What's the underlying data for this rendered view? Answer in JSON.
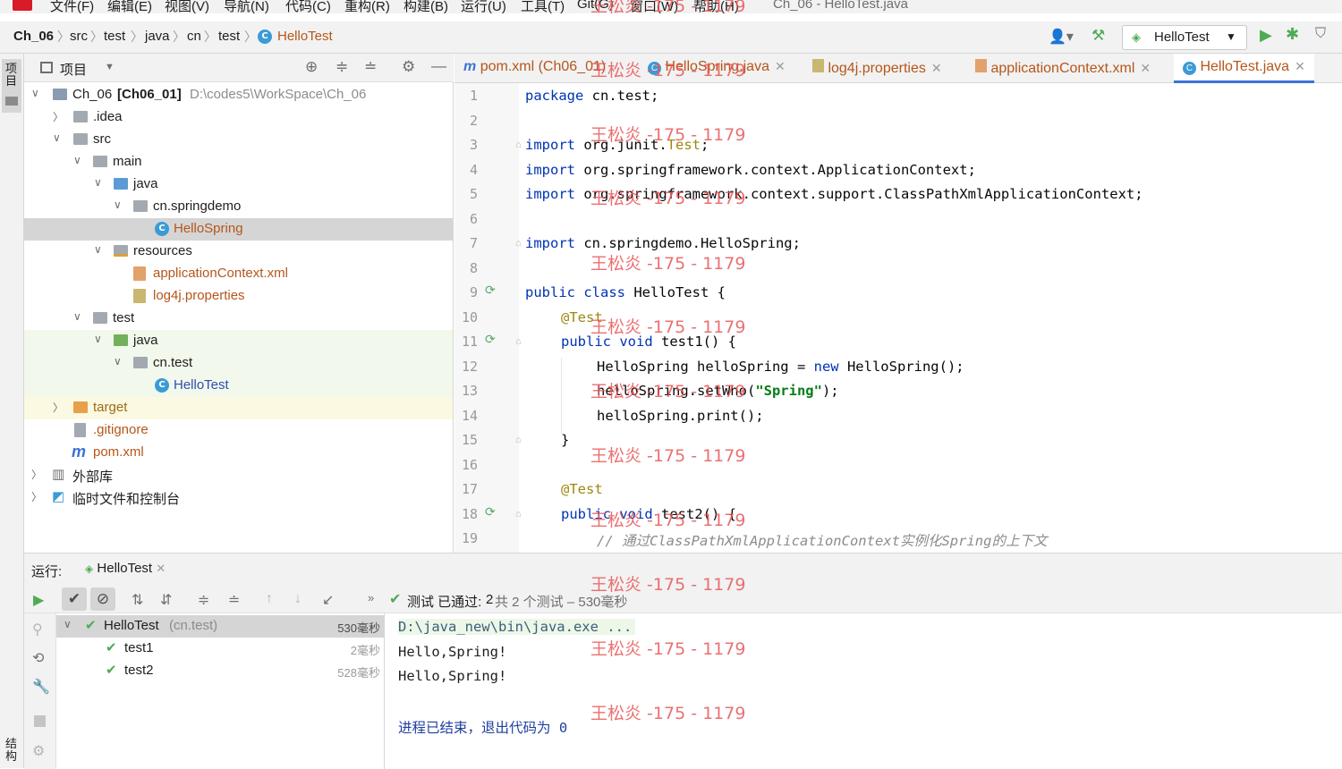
{
  "menu": [
    "文件(F)",
    "编辑(E)",
    "视图(V)",
    "导航(N)",
    "代码(C)",
    "重构(R)",
    "构建(B)",
    "运行(U)",
    "工具(T)",
    "Git(G)",
    "窗口(W)",
    "帮助(H)"
  ],
  "window_title": "Ch_06 - HelloTest.java",
  "breadcrumb": [
    "Ch_06",
    "src",
    "test",
    "java",
    "cn",
    "test",
    "HelloTest"
  ],
  "run_config": "HelloTest",
  "sidebar_left": {
    "project": "项目",
    "structure": "结构"
  },
  "project_panel": {
    "title": "项目",
    "tree": [
      {
        "label": "Ch_06",
        "module": "[Ch06_01]",
        "path": "D:\\codes5\\WorkSpace\\Ch_06"
      },
      {
        "label": ".idea"
      },
      {
        "label": "src"
      },
      {
        "label": "main"
      },
      {
        "label": "java"
      },
      {
        "label": "cn.springdemo"
      },
      {
        "label": "HelloSpring"
      },
      {
        "label": "resources"
      },
      {
        "label": "applicationContext.xml"
      },
      {
        "label": "log4j.properties"
      },
      {
        "label": "test"
      },
      {
        "label": "java"
      },
      {
        "label": "cn.test"
      },
      {
        "label": "HelloTest"
      },
      {
        "label": "target"
      },
      {
        "label": ".gitignore"
      },
      {
        "label": "pom.xml"
      },
      {
        "label": "外部库"
      },
      {
        "label": "临时文件和控制台"
      }
    ]
  },
  "editor_tabs": [
    {
      "label": "pom.xml (Ch06_01)",
      "icon": "m"
    },
    {
      "label": "HelloSpring.java",
      "icon": "C"
    },
    {
      "label": "log4j.properties",
      "icon": "props"
    },
    {
      "label": "applicationContext.xml",
      "icon": "xml"
    },
    {
      "label": "HelloTest.java",
      "icon": "C",
      "active": true
    }
  ],
  "code": {
    "line_numbers": [
      "1",
      "2",
      "3",
      "4",
      "5",
      "6",
      "7",
      "8",
      "9",
      "10",
      "11",
      "12",
      "13",
      "14",
      "15",
      "16",
      "17",
      "18",
      "19"
    ],
    "l1_kw": "package",
    "l1_rest": " cn.test;",
    "l3_kw": "import",
    "l3_pre": " org.junit.",
    "l3_cls": "Test",
    "l3_end": ";",
    "l4_kw": "import",
    "l4_rest": " org.springframework.context.ApplicationContext;",
    "l5_kw": "import",
    "l5_rest": " org.springframework.context.support.ClassPathXmlApplicationContext;",
    "l7_kw": "import",
    "l7_rest": " cn.springdemo.HelloSpring;",
    "l9_kw": "public class",
    "l9_rest": " HelloTest {",
    "l10_ann": "@Test",
    "l11_kw": "public void",
    "l11_rest": " test1() {",
    "l12_a": "HelloSpring helloSpring = ",
    "l12_kw": "new",
    "l12_b": " HelloSpring();",
    "l13_a": "helloSpring.setWho(",
    "l13_str": "\"Spring\"",
    "l13_b": ");",
    "l14": "helloSpring.print();",
    "l15": "}",
    "l17_ann": "@Test",
    "l18_kw": "public void",
    "l18_rest": " test2() {",
    "l19_cmt": "// 通过ClassPathXmlApplicationContext实例化Spring的上下文"
  },
  "run_panel": {
    "label": "运行:",
    "tab": "HelloTest",
    "status_prefix": "测试 已通过: ",
    "status_count": "2",
    "status_suffix": "共 2 个测试 – 530毫秒",
    "tests": [
      {
        "name": "HelloTest",
        "pkg": "(cn.test)",
        "time": "530毫秒"
      },
      {
        "name": "test1",
        "time": "2毫秒"
      },
      {
        "name": "test2",
        "time": "528毫秒"
      }
    ],
    "console": [
      "D:\\java_new\\bin\\java.exe ...",
      "Hello,Spring!",
      "Hello,Spring!",
      "",
      "进程已结束，退出代码为 0"
    ]
  },
  "watermark": "王松炎 -175 - 1179",
  "colors": {
    "accent": "#3b73d6",
    "pass": "#4eab56",
    "kw": "#0033b3",
    "ann": "#9e880d",
    "str": "#067d17",
    "watermark": "#e8585a"
  }
}
